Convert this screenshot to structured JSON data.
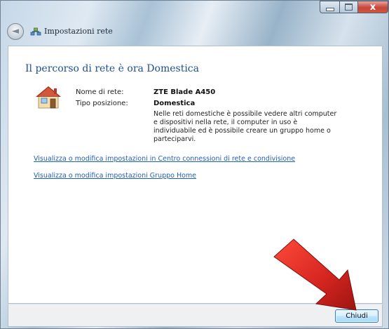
{
  "window": {
    "title": "Impostazioni rete",
    "controls": {
      "minimize": "minimize-icon",
      "maximize": "maximize-icon",
      "close": "close-icon",
      "close_glyph": "x"
    }
  },
  "nav": {
    "back_icon": "back-arrow-icon",
    "back_glyph": "◄",
    "network_icon": "network-settings-icon"
  },
  "main": {
    "heading": "Il percorso di rete è ora Domestica",
    "icon": "home-network-icon",
    "fields": [
      {
        "label": "Nome di rete:",
        "value": "ZTE Blade A450"
      },
      {
        "label": "Tipo posizione:",
        "value": "Domestica"
      }
    ],
    "description_lines": [
      "Nelle reti domestiche è possibile vedere altri computer",
      "e dispositivi nella rete, il computer in uso è",
      "individuabile ed è possibile creare un gruppo home o",
      "parteciparvi."
    ],
    "links": [
      "Visualizza o modifica impostazioni in Centro connessioni di rete e condivisione",
      "Visualizza o modifica impostazioni Gruppo Home"
    ]
  },
  "footer": {
    "close_button": "Chiudi"
  },
  "annotation": {
    "icon": "red-arrow-icon",
    "color": "#d3241f"
  }
}
